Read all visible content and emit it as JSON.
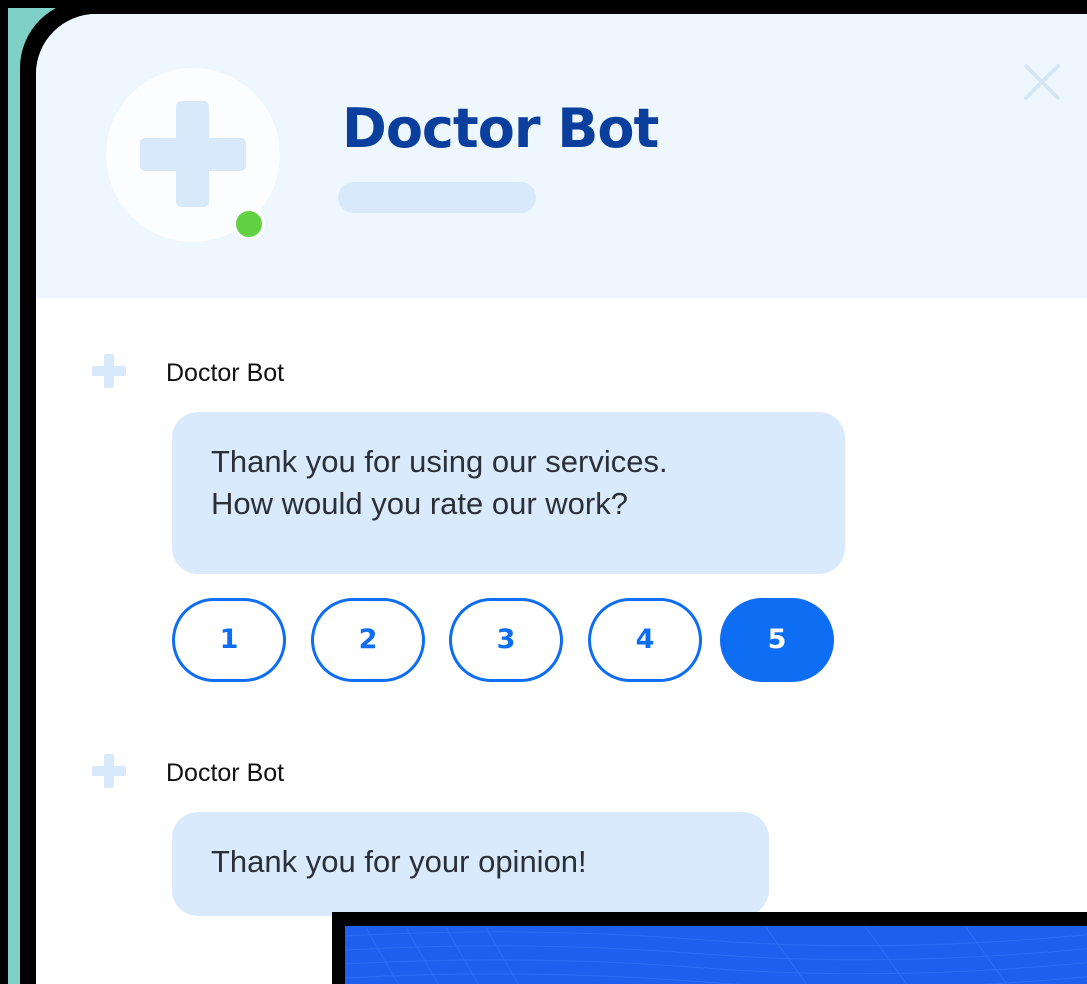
{
  "header": {
    "title": "Doctor Bot",
    "close_icon": "close-icon",
    "status": "online"
  },
  "messages": [
    {
      "sender": "Doctor Bot",
      "lines": [
        "Thank you for using our services.",
        "How would you rate our work?"
      ]
    },
    {
      "sender": "Doctor Bot",
      "lines": [
        "Thank you for your opinion!"
      ]
    }
  ],
  "rating": {
    "options": [
      "1",
      "2",
      "3",
      "4",
      "5"
    ],
    "selected": "5"
  },
  "colors": {
    "accent": "#0d6df3",
    "title": "#0b3f9e",
    "bubble": "#d9eafd",
    "header_bg": "#eef6fe",
    "status_online": "#61d141",
    "frame_bg": "#7fd0c6"
  }
}
